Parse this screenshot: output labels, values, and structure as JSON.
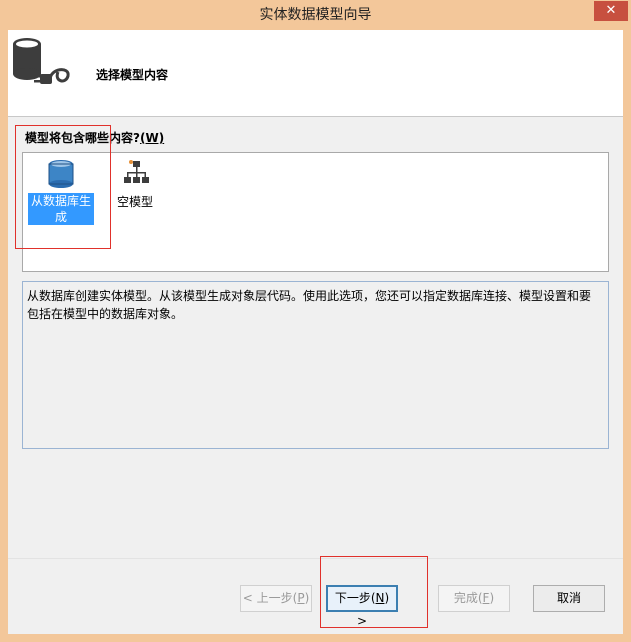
{
  "window": {
    "title": "实体数据模型向导",
    "close_label": "✕"
  },
  "header": {
    "title": "选择模型内容",
    "icon": "database-plug-icon"
  },
  "question": {
    "text": "模型将包含哪些内容?",
    "accel": "(W)"
  },
  "models": [
    {
      "label": "从数据库生成",
      "icon": "database-icon",
      "selected": true
    },
    {
      "label": "空模型",
      "icon": "empty-model-icon",
      "selected": false
    }
  ],
  "description": "从数据库创建实体模型。从该模型生成对象层代码。使用此选项，您还可以指定数据库连接、模型设置和要包括在模型中的数据库对象。",
  "buttons": {
    "prev": {
      "text": "< 上一步(",
      "accel": "P",
      "suffix": ")",
      "enabled": false
    },
    "next": {
      "text": "下一步(",
      "accel": "N",
      "suffix": ") >",
      "enabled": true
    },
    "finish": {
      "text": "完成(",
      "accel": "F",
      "suffix": ")",
      "enabled": false
    },
    "cancel": {
      "text": "取消",
      "enabled": true
    }
  },
  "colors": {
    "titlebar": "#f3c79a",
    "selection": "#3399ff",
    "highlight": "#e0312b"
  }
}
